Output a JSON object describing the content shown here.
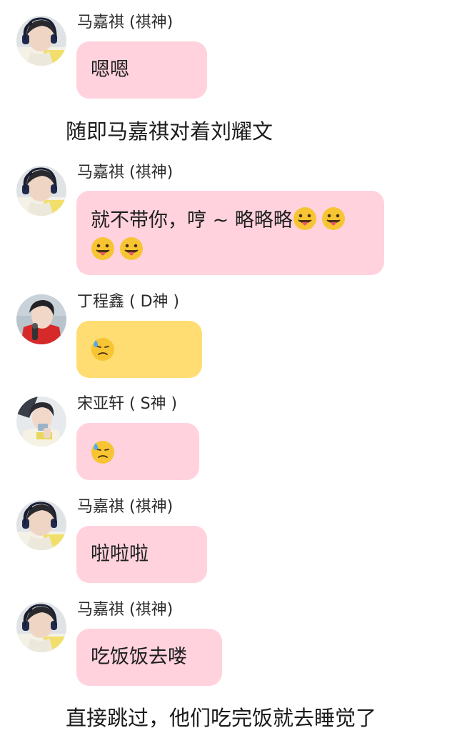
{
  "colors": {
    "pink_bubble": "#ffd2de",
    "yellow_bubble": "#ffdd72",
    "background": "#ffffff"
  },
  "messages": [
    {
      "sender": "马嘉祺 (祺神)",
      "avatar": "avatar-majiaqi",
      "text": "嗯嗯",
      "color": "pink"
    },
    {
      "sender": "马嘉祺 (祺神)",
      "avatar": "avatar-majiaqi",
      "text_line1": "就不带你，哼 ~ 略略略",
      "emoji": "tongue-out-emoji",
      "color": "pink"
    },
    {
      "sender": "丁程鑫 ( D神 )",
      "avatar": "avatar-dingchengxin",
      "emoji": "downcast-sweat-emoji",
      "color": "yellow"
    },
    {
      "sender": "宋亚轩 ( S神 )",
      "avatar": "avatar-songyaxuan",
      "emoji": "downcast-sweat-emoji",
      "color": "pink"
    },
    {
      "sender": "马嘉祺 (祺神)",
      "avatar": "avatar-majiaqi",
      "text": "啦啦啦",
      "color": "pink"
    },
    {
      "sender": "马嘉祺 (祺神)",
      "avatar": "avatar-majiaqi",
      "text": "吃饭饭去喽",
      "color": "pink"
    }
  ],
  "narration": {
    "line1": "随即马嘉祺对着刘耀文",
    "line2": "直接跳过，他们吃完饭就去睡觉了"
  }
}
